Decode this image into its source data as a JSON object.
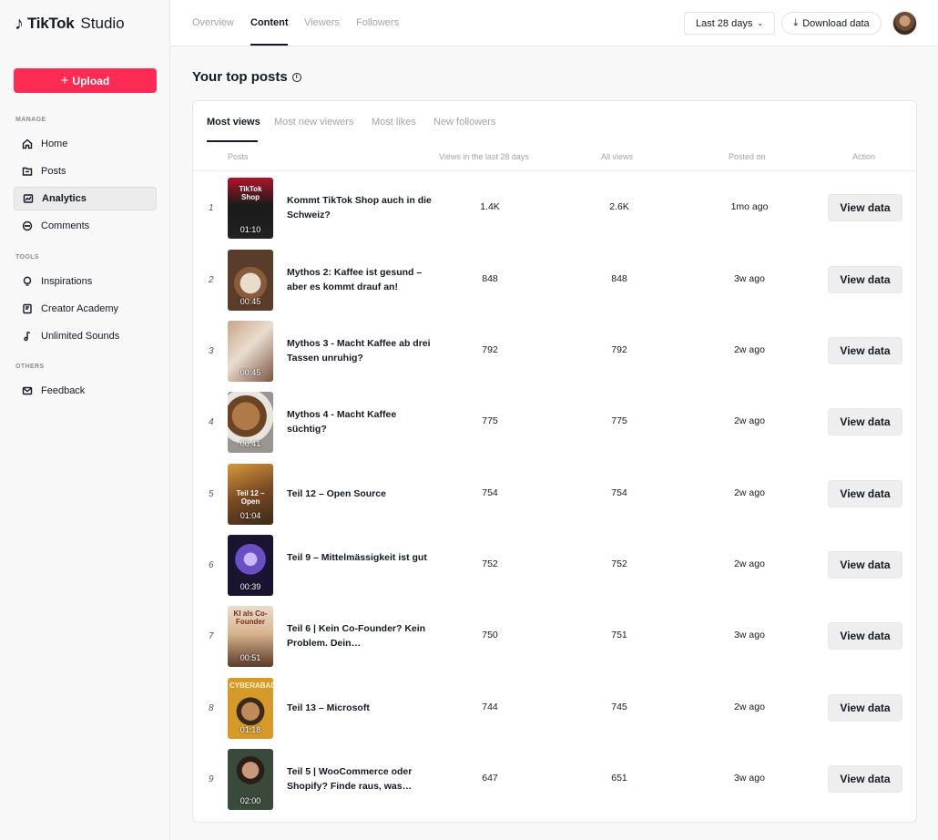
{
  "app": {
    "brand": "TikTok",
    "product": "Studio"
  },
  "sidebar": {
    "upload_label": "Upload",
    "sections": {
      "manage": "MANAGE",
      "tools": "TOOLS",
      "others": "OTHERS"
    },
    "items": [
      {
        "label": "Home",
        "icon": "home-icon"
      },
      {
        "label": "Posts",
        "icon": "folder-icon"
      },
      {
        "label": "Analytics",
        "icon": "analytics-icon",
        "active": true
      },
      {
        "label": "Comments",
        "icon": "comment-icon"
      },
      {
        "label": "Inspirations",
        "icon": "lightbulb-icon"
      },
      {
        "label": "Creator Academy",
        "icon": "book-icon"
      },
      {
        "label": "Unlimited Sounds",
        "icon": "music-note-icon"
      },
      {
        "label": "Feedback",
        "icon": "mail-icon"
      }
    ]
  },
  "topbar": {
    "tabs": [
      "Overview",
      "Content",
      "Viewers",
      "Followers"
    ],
    "active_tab": "Content",
    "range": "Last 28 days",
    "download_label": "Download data"
  },
  "main": {
    "title": "Your top posts",
    "tabs": [
      "Most views",
      "Most new viewers",
      "Most likes",
      "New followers"
    ],
    "active_tab": "Most views",
    "columns": [
      "Posts",
      "Views in the last 28 days",
      "All views",
      "Posted on",
      "Action"
    ],
    "rows": [
      {
        "rank": "1",
        "title": "Kommt TikTok Shop auch in die Schweiz?",
        "duration": "01:10",
        "caption": "TikTok Shop",
        "views28": "1.4K",
        "all": "2.6K",
        "posted": "1mo ago",
        "action": "View data"
      },
      {
        "rank": "2",
        "title": "Mythos 2: Kaffee ist gesund – aber es kommt drauf an!",
        "duration": "00:45",
        "caption": "",
        "views28": "848",
        "all": "848",
        "posted": "3w ago",
        "action": "View data"
      },
      {
        "rank": "3",
        "title": "Mythos 3 - Macht Kaffee ab drei Tassen unruhig?",
        "duration": "00:45",
        "caption": "",
        "views28": "792",
        "all": "792",
        "posted": "2w ago",
        "action": "View data"
      },
      {
        "rank": "4",
        "title": "Mythos 4 - Macht Kaffee süchtig?",
        "duration": "00:41",
        "caption": "",
        "views28": "775",
        "all": "775",
        "posted": "2w ago",
        "action": "View data"
      },
      {
        "rank": "5",
        "title": "Teil 12 – Open Source",
        "duration": "01:04",
        "caption": "Teil 12 – Open",
        "views28": "754",
        "all": "754",
        "posted": "2w ago",
        "action": "View data"
      },
      {
        "rank": "6",
        "title": "Teil 9 – Mittelmässigkeit ist gut",
        "duration": "00:39",
        "caption": "",
        "views28": "752",
        "all": "752",
        "posted": "2w ago",
        "action": "View data"
      },
      {
        "rank": "7",
        "title": "Teil 6 | Kein Co-Founder? Kein Problem. Dein…",
        "duration": "00:51",
        "caption": "KI als Co-Founder",
        "views28": "750",
        "all": "751",
        "posted": "3w ago",
        "action": "View data"
      },
      {
        "rank": "8",
        "title": "Teil 13 – Microsoft",
        "duration": "01:18",
        "caption": "CYBERABAD",
        "views28": "744",
        "all": "745",
        "posted": "2w ago",
        "action": "View data"
      },
      {
        "rank": "9",
        "title": "Teil 5 | WooCommerce oder Shopify? Finde raus, was…",
        "duration": "02:00",
        "caption": "",
        "views28": "647",
        "all": "651",
        "posted": "3w ago",
        "action": "View data"
      }
    ]
  },
  "colors": {
    "accent": "#fe2c55",
    "text": "#161823",
    "muted": "#a3a4a8"
  }
}
